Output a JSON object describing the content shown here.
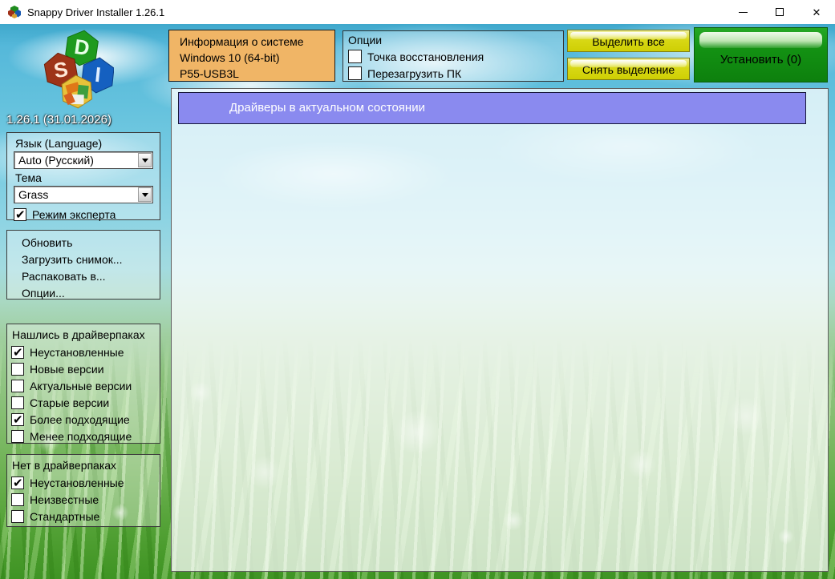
{
  "window": {
    "title": "Snappy Driver Installer 1.26.1",
    "close_glyph": "✕"
  },
  "sidebar": {
    "logo_letters": {
      "s": "S",
      "d": "D",
      "i": "I"
    },
    "version": "1.26.1 (31.01.2026)",
    "language_label": "Язык (Language)",
    "language_value": "Auto (Русский)",
    "theme_label": "Тема",
    "theme_value": "Grass",
    "expert_mode": {
      "label": "Режим эксперта",
      "checked": true
    },
    "menu": {
      "update": "Обновить",
      "load_snapshot": "Загрузить снимок...",
      "extract_to": "Распаковать в...",
      "options": "Опции..."
    },
    "found_section": {
      "title": "Нашлись в драйверпаках",
      "items": [
        {
          "label": "Неустановленные",
          "checked": true
        },
        {
          "label": "Новые версии",
          "checked": false
        },
        {
          "label": "Актуальные версии",
          "checked": false
        },
        {
          "label": "Старые версии",
          "checked": false
        },
        {
          "label": "Более подходящие",
          "checked": true
        },
        {
          "label": "Менее подходящие",
          "checked": false
        }
      ]
    },
    "missing_section": {
      "title": "Нет в драйверпаках",
      "items": [
        {
          "label": "Неустановленные",
          "checked": true
        },
        {
          "label": "Неизвестные",
          "checked": false
        },
        {
          "label": "Стандартные",
          "checked": false
        }
      ]
    }
  },
  "topbar": {
    "system_info": {
      "title": "Информация о системе",
      "os": "Windows 10 (64-bit)",
      "motherboard": "P55-USB3L"
    },
    "options": {
      "title": "Опции",
      "items": [
        {
          "label": "Точка восстановления",
          "checked": false
        },
        {
          "label": "Перезагрузить ПК",
          "checked": false
        }
      ]
    },
    "select_all_label": "Выделить все",
    "deselect_label": "Снять выделение",
    "install_label": "Установить (0)"
  },
  "main": {
    "status_banner": "Драйверы в актуальном состоянии"
  },
  "colors": {
    "info_panel": "#f0b566",
    "yellow_button": "#d8d815",
    "install_button": "#139113",
    "status_banner": "#8a8aef",
    "sky": "#63c1dd",
    "grass": "#57a43a"
  }
}
